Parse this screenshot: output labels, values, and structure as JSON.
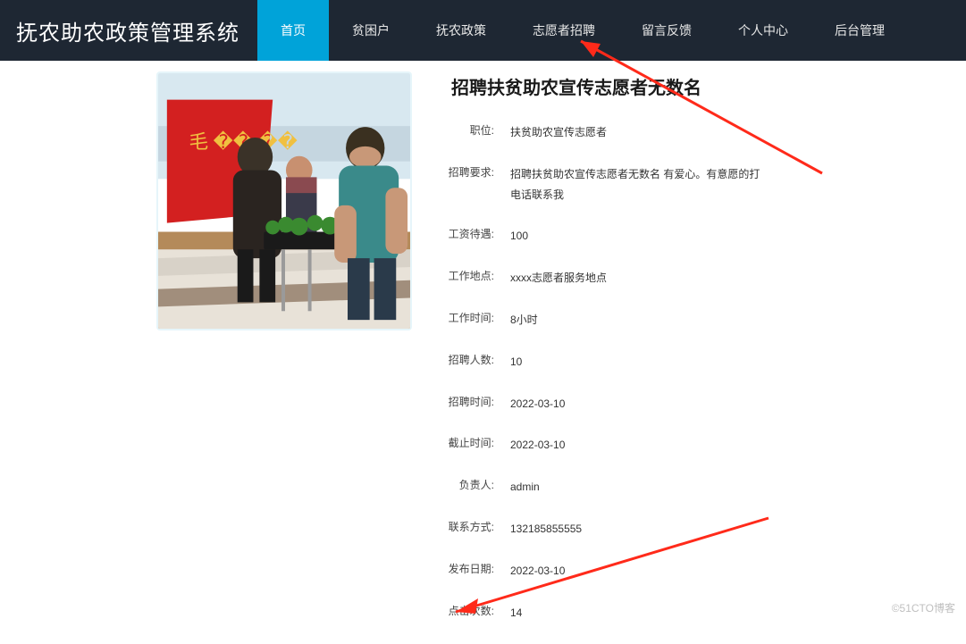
{
  "header": {
    "title": "抚农助农政策管理系统",
    "nav": [
      {
        "label": "首页",
        "active": true
      },
      {
        "label": "贫困户",
        "active": false
      },
      {
        "label": "抚农政策",
        "active": false
      },
      {
        "label": "志愿者招聘",
        "active": false
      },
      {
        "label": "留言反馈",
        "active": false
      },
      {
        "label": "个人中心",
        "active": false
      },
      {
        "label": "后台管理",
        "active": false
      }
    ]
  },
  "detail": {
    "title": "招聘扶贫助农宣传志愿者无数名",
    "rows": [
      {
        "label": "职位:",
        "value": "扶贫助农宣传志愿者"
      },
      {
        "label": "招聘要求:",
        "value": "招聘扶贫助农宣传志愿者无数名 有爱心。有意愿的打电话联系我"
      },
      {
        "label": "工资待遇:",
        "value": "100"
      },
      {
        "label": "工作地点:",
        "value": "xxxx志愿者服务地点"
      },
      {
        "label": "工作时间:",
        "value": "8小时"
      },
      {
        "label": "招聘人数:",
        "value": "10"
      },
      {
        "label": "招聘时间:",
        "value": "2022-03-10"
      },
      {
        "label": "截止时间:",
        "value": "2022-03-10"
      },
      {
        "label": "负责人:",
        "value": "admin"
      },
      {
        "label": "联系方式:",
        "value": "132185855555"
      },
      {
        "label": "发布日期:",
        "value": "2022-03-10"
      },
      {
        "label": "点击次数:",
        "value": "14"
      }
    ]
  },
  "watermark": "©51CTO博客",
  "arrow_color": "#ff2a1a"
}
